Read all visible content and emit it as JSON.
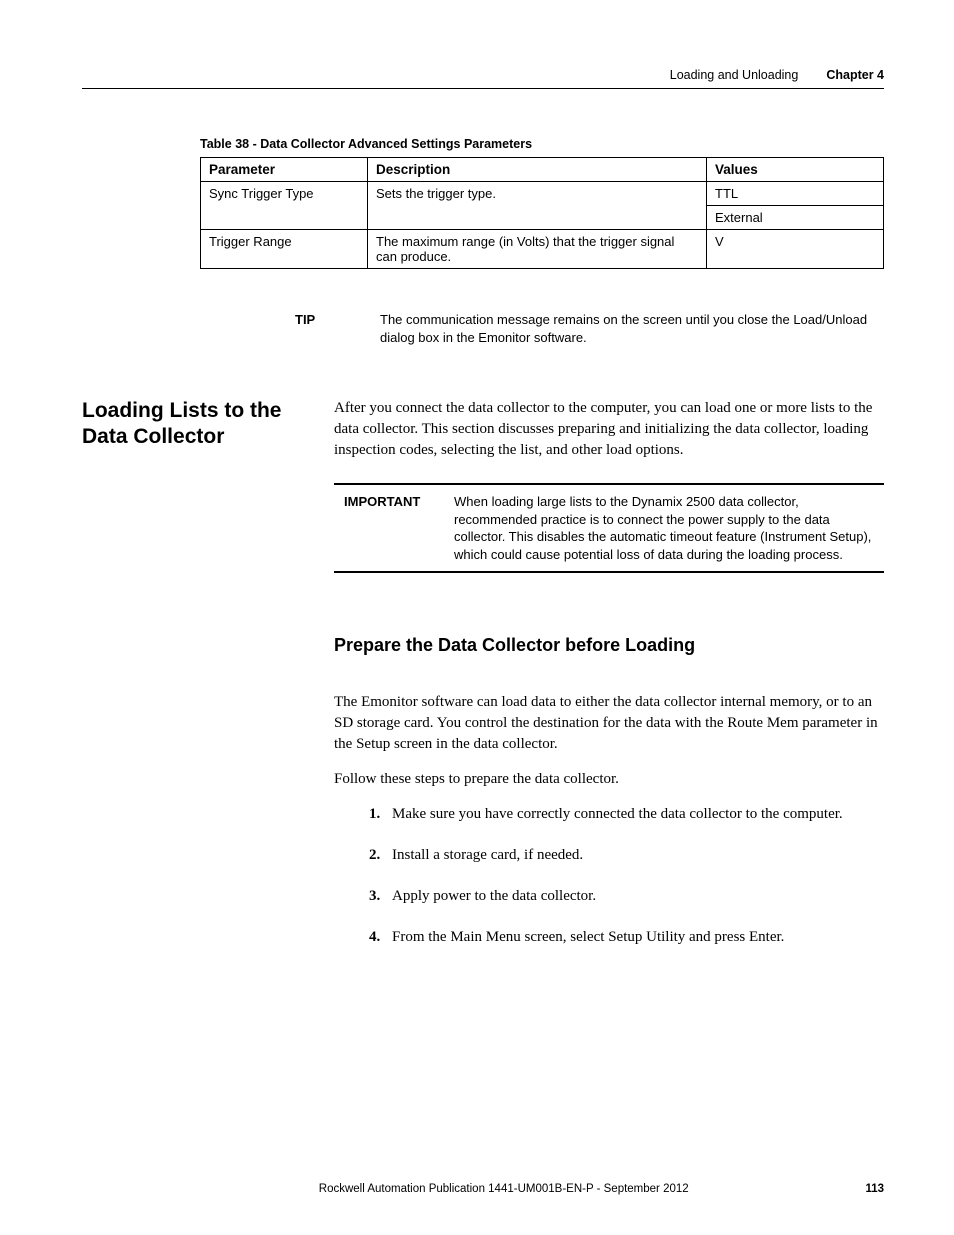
{
  "header": {
    "section": "Loading and Unloading",
    "chapter": "Chapter 4"
  },
  "table": {
    "caption": "Table 38 - Data Collector Advanced Settings Parameters",
    "headers": {
      "parameter": "Parameter",
      "description": "Description",
      "values": "Values"
    },
    "rows": [
      {
        "parameter": "Sync Trigger Type",
        "description": "Sets the trigger type.",
        "values": [
          "TTL",
          "External"
        ]
      },
      {
        "parameter": "Trigger Range",
        "description": "The maximum range (in Volts) that the trigger signal can produce.",
        "values": [
          "V"
        ]
      }
    ]
  },
  "tip": {
    "label": "TIP",
    "text": "The communication message remains on the screen until you close the Load/Unload dialog box in the Emonitor software."
  },
  "section": {
    "heading": "Loading Lists to the Data Collector",
    "intro": "After you connect the data collector to the computer, you can load one or more lists to the data collector. This section discusses preparing and initializing the data collector, loading inspection codes, selecting the list, and other load options."
  },
  "important": {
    "label": "IMPORTANT",
    "text": "When loading large lists to the Dynamix 2500 data collector, recommended practice is to connect the power supply to the data collector. This disables the automatic timeout feature (Instrument Setup), which could cause potential loss of data during the loading process."
  },
  "subsection": {
    "heading": "Prepare the Data Collector before Loading",
    "p1": "The Emonitor software can load data to either the data collector internal memory, or to an SD storage card. You control the destination for the data with the Route Mem parameter in the Setup screen in the data collector.",
    "p2": "Follow these steps to prepare the data collector.",
    "steps": [
      "Make sure you have correctly connected the data collector to the computer.",
      "Install a storage card, if needed.",
      "Apply power to the data collector.",
      "From the Main Menu screen, select Setup Utility and press Enter."
    ]
  },
  "footer": {
    "publication": "Rockwell Automation Publication 1441-UM001B-EN-P - September 2012",
    "page": "113"
  }
}
